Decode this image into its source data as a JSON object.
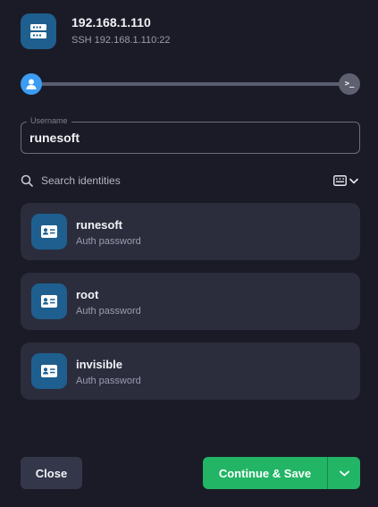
{
  "host": {
    "title": "192.168.1.110",
    "subtitle": "SSH 192.168.1.110:22",
    "icon": "server-icon"
  },
  "progress": {
    "fraction": 0.0,
    "start_icon": "user-icon",
    "end_icon": "terminal-icon",
    "end_glyph": ">_"
  },
  "username": {
    "label": "Username",
    "value": "runesoft"
  },
  "search": {
    "placeholder": "Search identities"
  },
  "identities": [
    {
      "name": "runesoft",
      "auth": "Auth password",
      "icon": "id-card-icon"
    },
    {
      "name": "root",
      "auth": "Auth password",
      "icon": "id-card-icon"
    },
    {
      "name": "invisible",
      "auth": "Auth password",
      "icon": "id-card-icon"
    }
  ],
  "footer": {
    "close_label": "Close",
    "continue_label": "Continue & Save"
  },
  "colors": {
    "background": "#1a1b26",
    "card": "#2b2d3d",
    "accent_blue": "#3b9cf2",
    "icon_bg": "#1e5f8f",
    "primary_green": "#22b566"
  }
}
